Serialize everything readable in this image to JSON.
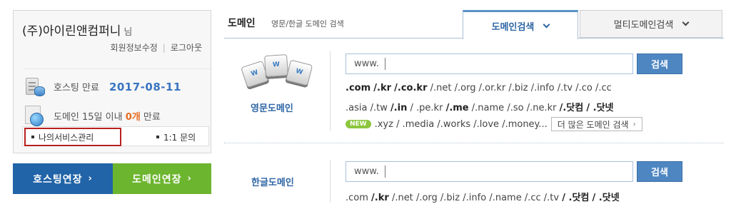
{
  "user": {
    "company": "(주)아이린앤컴퍼니",
    "suffix": "님",
    "edit_member": "회원정보수정",
    "separator": "|",
    "logout": "로그아웃",
    "hosting_label": "호스팅 만료",
    "hosting_date": "2017-08-11",
    "domain_label_pre": "도메인 15일 이내",
    "domain_count": "0개",
    "domain_label_post": "만료",
    "my_services": "나의서비스관리",
    "inquiry": "1:1 문의"
  },
  "actions": {
    "hosting_extend": "호스팅연장",
    "domain_extend": "도메인연장",
    "arrow": "›"
  },
  "domain": {
    "section_title": "도메인",
    "section_sub": "영문/한글 도메인 검색",
    "tab_search": "도메인검색",
    "tab_multi": "멀티도메인검색",
    "english": {
      "label": "영문도메인",
      "input_prefix": "www.",
      "button": "검색",
      "row1": [
        ".com",
        "/.kr",
        "/.co.kr",
        "/.net",
        "/.org",
        "/.or.kr",
        "/.biz",
        "/.info",
        "/.tv",
        "/.co",
        "/.cc"
      ],
      "row2": [
        ".asia",
        "/.tw",
        "/.in",
        "/ .pe.kr",
        "/.me",
        "/.name",
        "/.so",
        "/.ne.kr",
        "/.닷컴",
        "/ .닷넷"
      ],
      "new_badge": "NEW",
      "row3": [
        ".xyz",
        "/ .media",
        "/.works",
        "/.love",
        "/.money..."
      ],
      "more_button": "더 많은 도메인 검색",
      "more_arrow": "›"
    },
    "korean": {
      "label": "한글도메인",
      "input_prefix": "www.",
      "button": "검색",
      "row": [
        ".com",
        "/.kr",
        "/.net",
        "/.org",
        "/.biz",
        "/.info",
        "/.name",
        "/.cc",
        "/.tv",
        "/ .닷컴",
        "/ .닷넷"
      ]
    },
    "key_labels": [
      "W",
      "W",
      "W"
    ]
  },
  "colors": {
    "accent_blue": "#2f66a6",
    "hosting_button": "#2164a8",
    "domain_button": "#6cb52e",
    "highlight_count": "#e96b1f",
    "annotation_red": "#b8221f"
  }
}
